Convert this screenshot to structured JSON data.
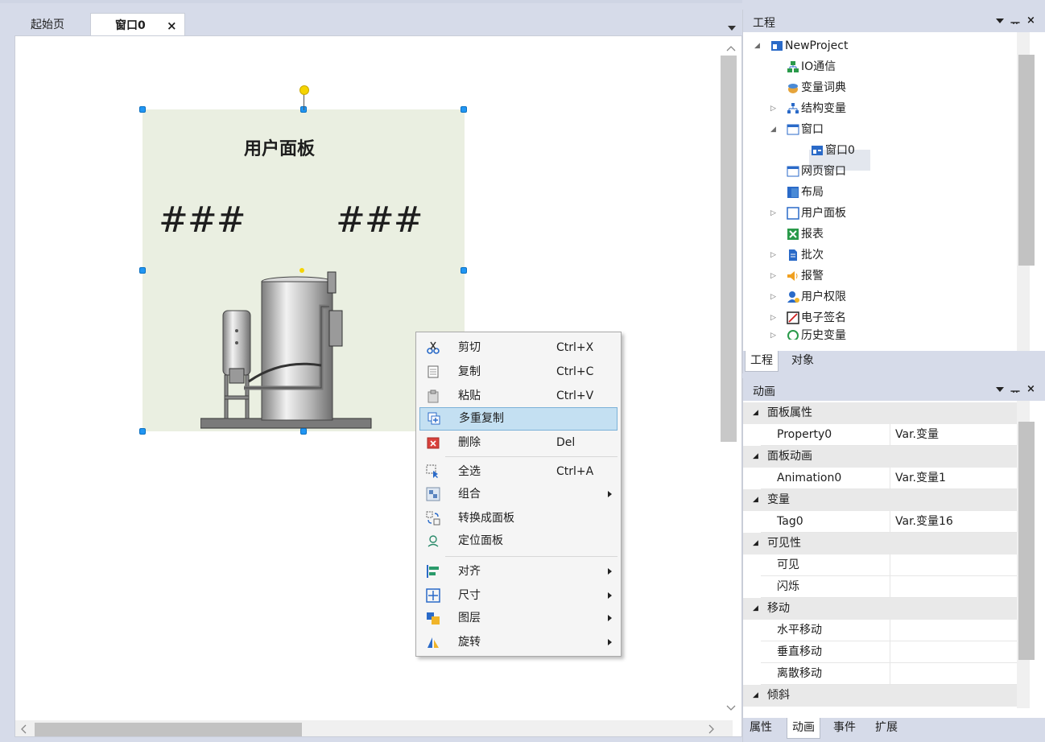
{
  "doc_tabs": {
    "start_page": "起始页",
    "window0": "窗口0",
    "close_glyph": "×"
  },
  "canvas": {
    "panel_title": "用户面板",
    "hash_left": "###",
    "hash_right": "###",
    "panel_bg": "#eaefe1"
  },
  "context_menu": {
    "items": [
      {
        "label": "剪切",
        "shortcut": "Ctrl+X",
        "icon": "scissors-icon"
      },
      {
        "label": "复制",
        "shortcut": "Ctrl+C",
        "icon": "copy-icon"
      },
      {
        "label": "粘贴",
        "shortcut": "Ctrl+V",
        "icon": "paste-icon"
      },
      {
        "label": "多重复制",
        "shortcut": "",
        "icon": "multi-copy-icon",
        "highlighted": true
      },
      {
        "label": "删除",
        "shortcut": "Del",
        "icon": "delete-icon"
      },
      {
        "label": "全选",
        "shortcut": "Ctrl+A",
        "icon": "select-all-icon"
      },
      {
        "label": "组合",
        "shortcut": "",
        "icon": "group-icon",
        "submenu": true
      },
      {
        "label": "转换成面板",
        "shortcut": "",
        "icon": "convert-panel-icon"
      },
      {
        "label": "定位面板",
        "shortcut": "",
        "icon": "locate-panel-icon"
      },
      {
        "label": "对齐",
        "shortcut": "",
        "icon": "align-icon",
        "submenu": true
      },
      {
        "label": "尺寸",
        "shortcut": "",
        "icon": "size-icon",
        "submenu": true
      },
      {
        "label": "图层",
        "shortcut": "",
        "icon": "layer-icon",
        "submenu": true
      },
      {
        "label": "旋转",
        "shortcut": "",
        "icon": "rotate-icon",
        "submenu": true
      }
    ],
    "highlight_color": "#c4e0f2"
  },
  "project_panel": {
    "title": "工程",
    "pin_glyph": "ᅲ",
    "close_glyph": "×",
    "tree": [
      {
        "label": "NewProject",
        "depth": 0,
        "toggle": "◢",
        "icon": "project-icon"
      },
      {
        "label": "IO通信",
        "depth": 1,
        "toggle": "",
        "icon": "network-icon"
      },
      {
        "label": "变量词典",
        "depth": 1,
        "toggle": "",
        "icon": "dictionary-icon"
      },
      {
        "label": "结构变量",
        "depth": 1,
        "toggle": "▷",
        "icon": "struct-icon"
      },
      {
        "label": "窗口",
        "depth": 1,
        "toggle": "◢",
        "icon": "window-icon"
      },
      {
        "label": "窗口0",
        "depth": 2,
        "toggle": "",
        "icon": "window0-icon"
      },
      {
        "label": "网页窗口",
        "depth": 1,
        "toggle": "",
        "icon": "webpage-icon"
      },
      {
        "label": "布局",
        "depth": 1,
        "toggle": "",
        "icon": "layout-icon"
      },
      {
        "label": "用户面板",
        "depth": 1,
        "toggle": "▷",
        "icon": "user-panel-icon"
      },
      {
        "label": "报表",
        "depth": 1,
        "toggle": "",
        "icon": "report-icon"
      },
      {
        "label": "批次",
        "depth": 1,
        "toggle": "▷",
        "icon": "batch-icon"
      },
      {
        "label": "报警",
        "depth": 1,
        "toggle": "▷",
        "icon": "alarm-icon"
      },
      {
        "label": "用户权限",
        "depth": 1,
        "toggle": "▷",
        "icon": "user-rights-icon"
      },
      {
        "label": "电子签名",
        "depth": 1,
        "toggle": "▷",
        "icon": "signature-icon"
      },
      {
        "label": "历史变量",
        "depth": 1,
        "toggle": "▷",
        "icon": "history-icon"
      }
    ],
    "tabs": [
      "工程",
      "对象"
    ]
  },
  "animation_panel": {
    "title": "动画",
    "pin_glyph": "ᅲ",
    "close_glyph": "×",
    "grid": [
      {
        "category": "面板属性",
        "rows": [
          {
            "name": "Property0",
            "value": "Var.变量"
          }
        ]
      },
      {
        "category": "面板动画",
        "rows": [
          {
            "name": "Animation0",
            "value": "Var.变量1"
          }
        ]
      },
      {
        "category": "变量",
        "rows": [
          {
            "name": "Tag0",
            "value": "Var.变量16"
          }
        ]
      },
      {
        "category": "可见性",
        "rows": [
          {
            "name": "可见",
            "value": ""
          },
          {
            "name": "闪烁",
            "value": ""
          }
        ]
      },
      {
        "category": "移动",
        "rows": [
          {
            "name": "水平移动",
            "value": ""
          },
          {
            "name": "垂直移动",
            "value": ""
          },
          {
            "name": "离散移动",
            "value": ""
          }
        ]
      },
      {
        "category": "倾斜",
        "rows": []
      }
    ],
    "tabs": [
      "属性",
      "动画",
      "事件",
      "扩展"
    ]
  }
}
